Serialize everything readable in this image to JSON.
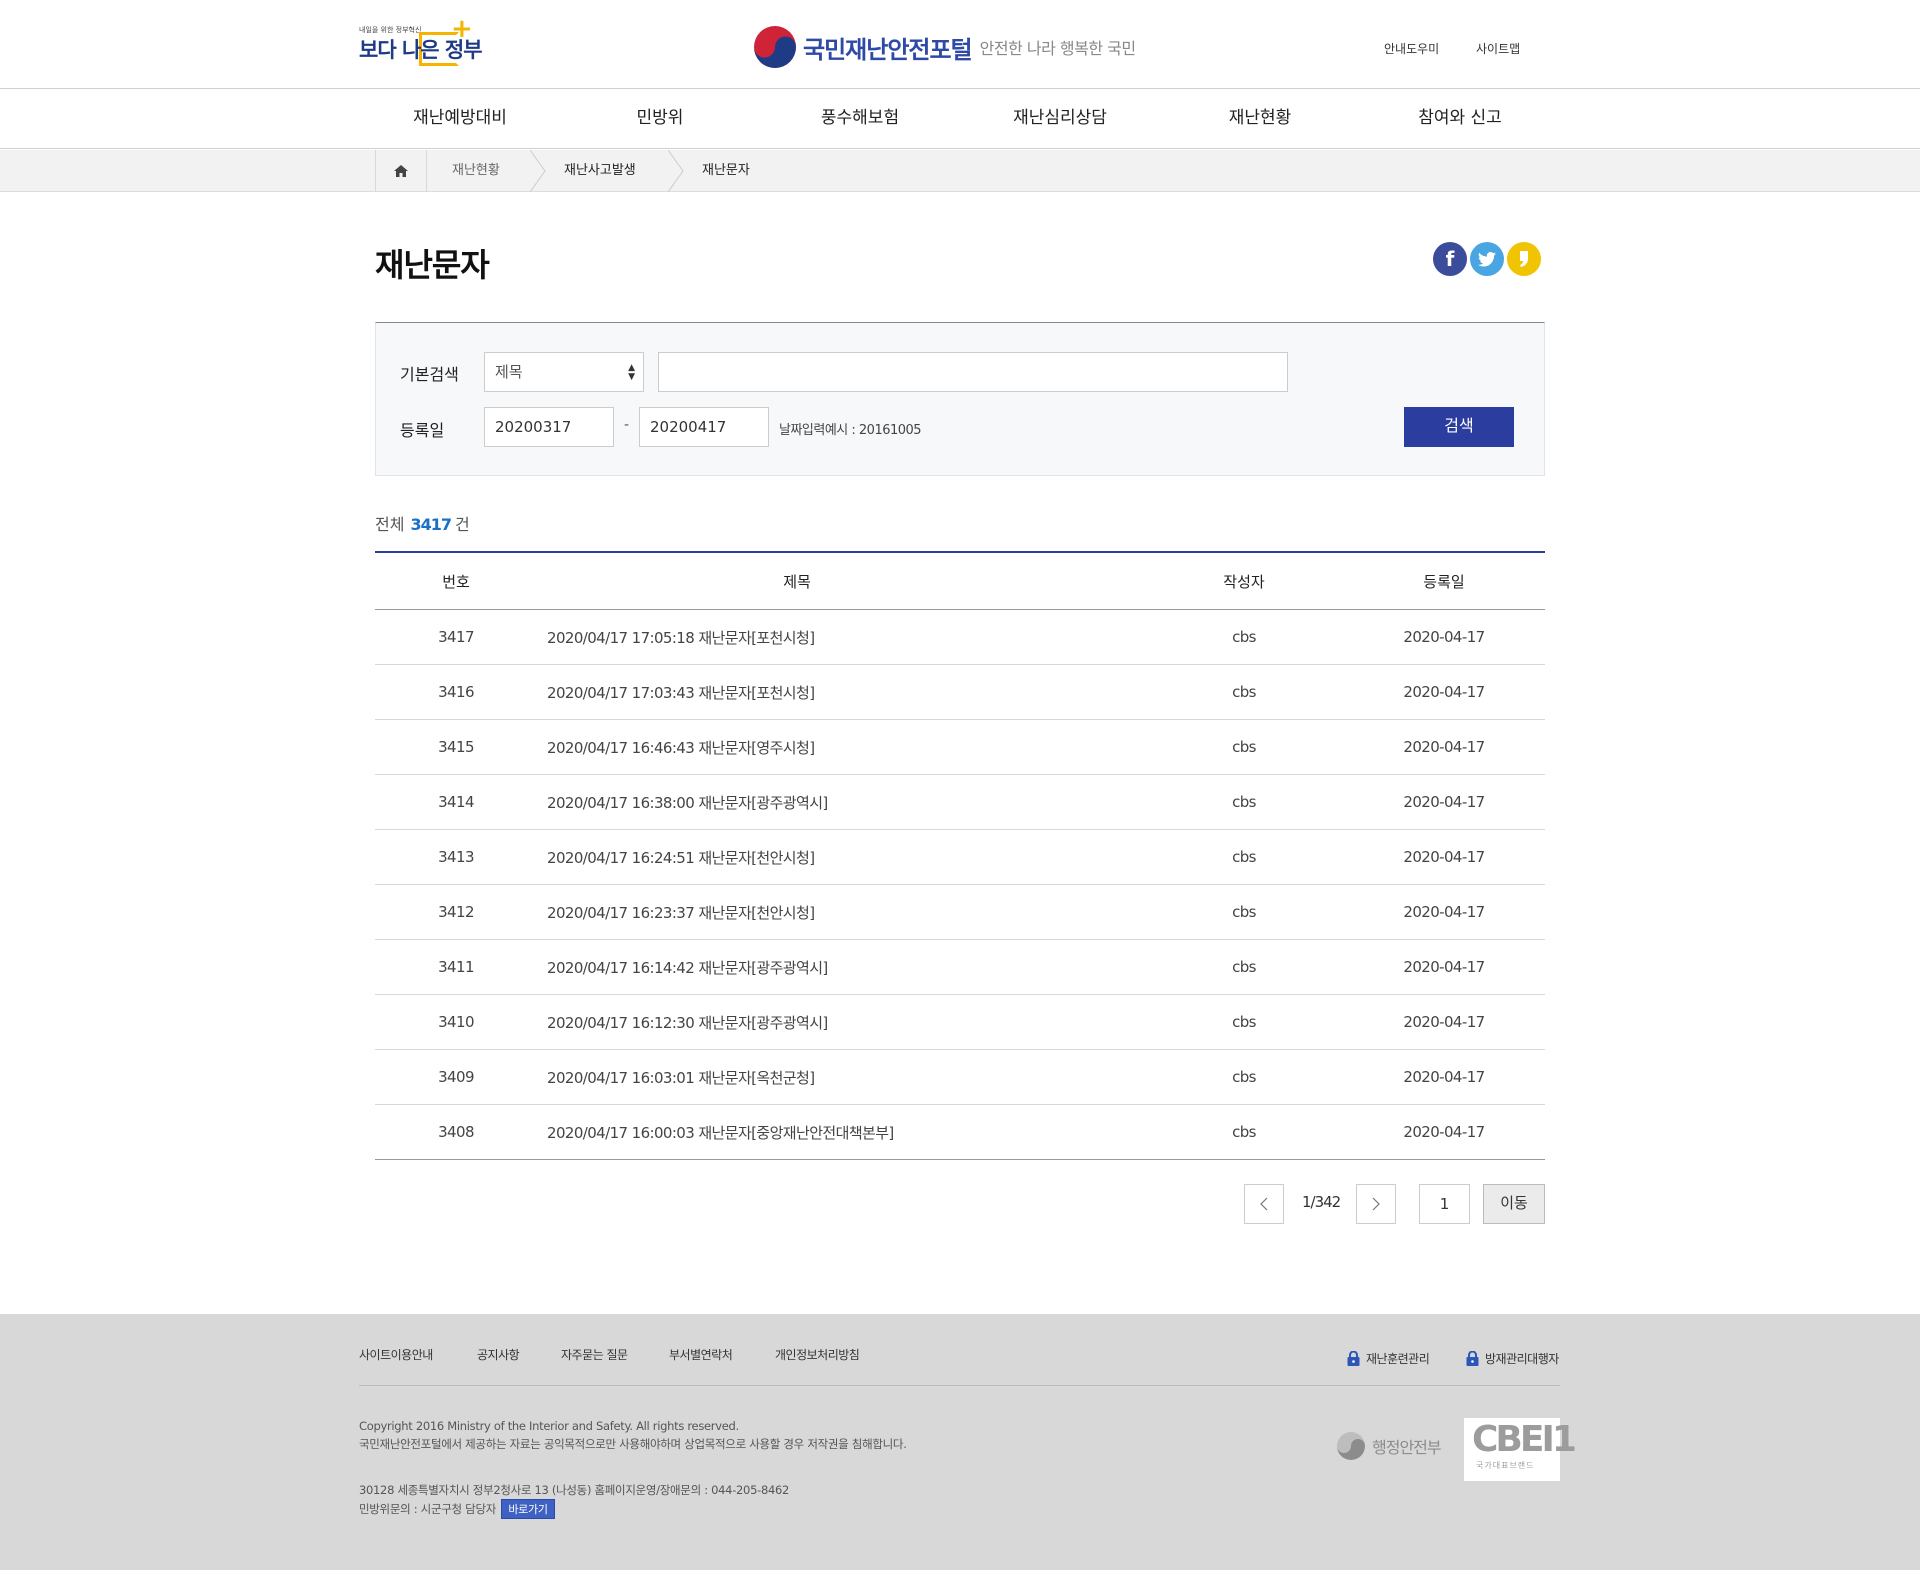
{
  "header": {
    "gov_logo_small": "내일을 위한 정부혁신",
    "gov_logo_big": "보다 나은 정부",
    "portal_name": "국민재난안전포털",
    "portal_slogan": "안전한 나라 행복한 국민",
    "util_links": [
      "안내도우미",
      "사이트맵"
    ]
  },
  "gnb": [
    "재난예방대비",
    "민방위",
    "풍수해보험",
    "재난심리상담",
    "재난현황",
    "참여와 신고"
  ],
  "breadcrumb": {
    "home_icon": "home-icon",
    "items": [
      "재난현황",
      "재난사고발생",
      "재난문자"
    ]
  },
  "page": {
    "title": "재난문자"
  },
  "sns": [
    {
      "name": "facebook-icon",
      "glyph": "f",
      "color": "#3b4c9a"
    },
    {
      "name": "twitter-icon",
      "glyph": "t",
      "color": "#4aa6e3"
    },
    {
      "name": "kakaostory-icon",
      "glyph": "❜",
      "color": "#f0c400"
    }
  ],
  "search": {
    "basic_label": "기본검색",
    "field_select": "제목",
    "keyword_value": "",
    "date_label": "등록일",
    "date_from": "20200317",
    "date_sep": "-",
    "date_to": "20200417",
    "date_hint": "날짜입력예시 : 20161005",
    "button": "검색"
  },
  "total": {
    "prefix": "전체",
    "count": "3417",
    "suffix": "건"
  },
  "table": {
    "headers": [
      "번호",
      "제목",
      "작성자",
      "등록일"
    ],
    "rows": [
      {
        "no": "3417",
        "title": "2020/04/17 17:05:18 재난문자[포천시청]",
        "author": "cbs",
        "date": "2020-04-17"
      },
      {
        "no": "3416",
        "title": "2020/04/17 17:03:43 재난문자[포천시청]",
        "author": "cbs",
        "date": "2020-04-17"
      },
      {
        "no": "3415",
        "title": "2020/04/17 16:46:43 재난문자[영주시청]",
        "author": "cbs",
        "date": "2020-04-17"
      },
      {
        "no": "3414",
        "title": "2020/04/17 16:38:00 재난문자[광주광역시]",
        "author": "cbs",
        "date": "2020-04-17"
      },
      {
        "no": "3413",
        "title": "2020/04/17 16:24:51 재난문자[천안시청]",
        "author": "cbs",
        "date": "2020-04-17"
      },
      {
        "no": "3412",
        "title": "2020/04/17 16:23:37 재난문자[천안시청]",
        "author": "cbs",
        "date": "2020-04-17"
      },
      {
        "no": "3411",
        "title": "2020/04/17 16:14:42 재난문자[광주광역시]",
        "author": "cbs",
        "date": "2020-04-17"
      },
      {
        "no": "3410",
        "title": "2020/04/17 16:12:30 재난문자[광주광역시]",
        "author": "cbs",
        "date": "2020-04-17"
      },
      {
        "no": "3409",
        "title": "2020/04/17 16:03:01 재난문자[옥천군청]",
        "author": "cbs",
        "date": "2020-04-17"
      },
      {
        "no": "3408",
        "title": "2020/04/17 16:00:03 재난문자[중앙재난안전대책본부]",
        "author": "cbs",
        "date": "2020-04-17"
      }
    ]
  },
  "pager": {
    "info": "1/342",
    "page_value": "1",
    "go_label": "이동"
  },
  "footer": {
    "links": [
      "사이트이용안내",
      "공지사항",
      "자주묻는 질문",
      "부서별연락처",
      "개인정보처리방침"
    ],
    "admin_links": [
      "재난훈련관리",
      "방재관리대행자"
    ],
    "copyright": "Copyright 2016 Ministry of the Interior and Safety. All rights reserved.",
    "notice": "국민재난안전포털에서 제공하는 자료는 공익목적으로만 사용해야하며 상업목적으로 사용할 경우 저작권을 침해합니다.",
    "address": "30128 세종특별자치시 정부2청사로 13 (나성동)  홈페이지운영/장애문의 : 044-205-8462",
    "civil_contact": "민방위문의 : 시군구청 담당자",
    "goto_button": "바로가기",
    "ministry": "행정안전부",
    "brand_logo": "CBEI1",
    "brand_sub": "국가대표브랜드"
  }
}
